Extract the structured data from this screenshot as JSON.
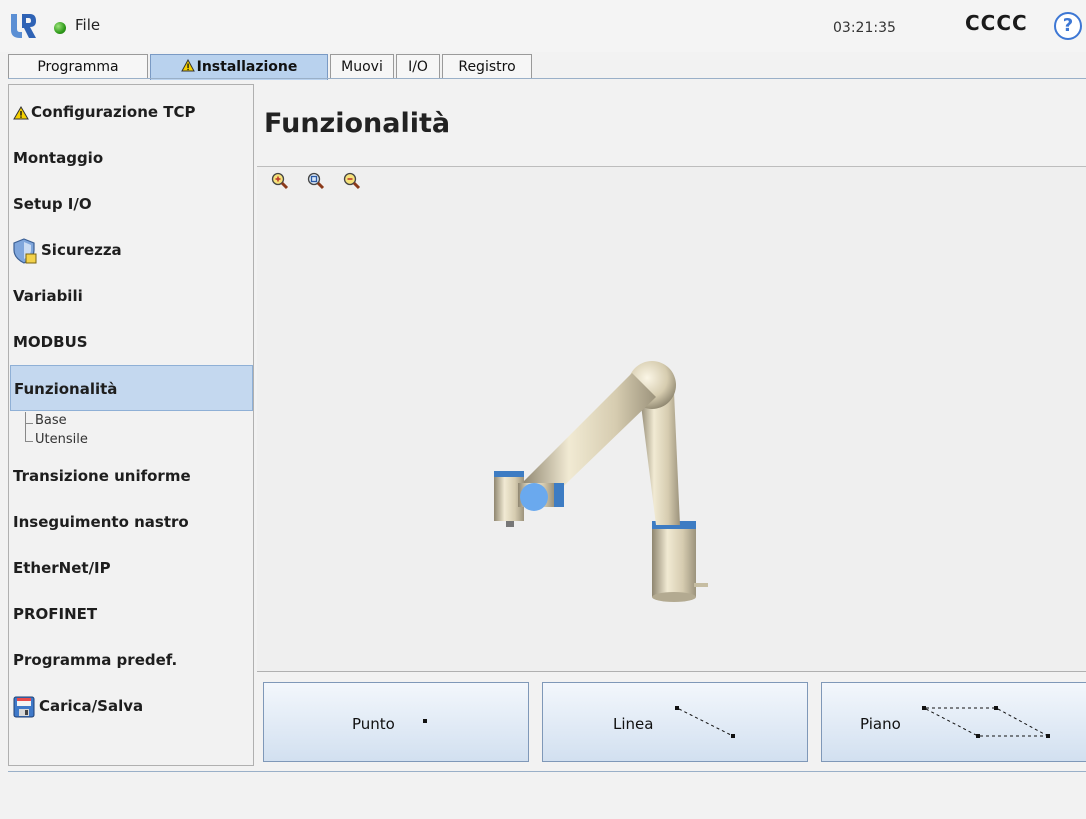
{
  "topbar": {
    "file_label": "File",
    "time": "03:21:35",
    "robot_name": "CCCC",
    "help_symbol": "?"
  },
  "tabs": [
    {
      "label": "Programma",
      "active": false
    },
    {
      "label": "Installazione",
      "active": true,
      "warning": true
    },
    {
      "label": "Muovi",
      "active": false
    },
    {
      "label": "I/O",
      "active": false
    },
    {
      "label": "Registro",
      "active": false
    }
  ],
  "sidebar": {
    "items": [
      {
        "label": "Configurazione TCP",
        "icon": "warning-icon"
      },
      {
        "label": "Montaggio"
      },
      {
        "label": "Setup I/O"
      },
      {
        "label": "Sicurezza",
        "icon": "shield-icon"
      },
      {
        "label": "Variabili"
      },
      {
        "label": "MODBUS"
      },
      {
        "label": "Funzionalità",
        "selected": true
      },
      {
        "label": "Transizione uniforme"
      },
      {
        "label": "Inseguimento nastro"
      },
      {
        "label": "EtherNet/IP"
      },
      {
        "label": "PROFINET"
      },
      {
        "label": "Programma predef."
      },
      {
        "label": "Carica/Salva",
        "icon": "floppy-disk-icon"
      }
    ],
    "subitems": [
      "Base",
      "Utensile"
    ]
  },
  "main": {
    "title": "Funzionalità",
    "zoom_icons": [
      "zoom-in-icon",
      "zoom-fit-icon",
      "zoom-out-icon"
    ]
  },
  "buttons": {
    "point": "Punto",
    "line": "Linea",
    "plane": "Piano"
  },
  "colors": {
    "selected": "#c4d8ef",
    "accent": "#3d77d4",
    "warning": "#f5d000"
  }
}
